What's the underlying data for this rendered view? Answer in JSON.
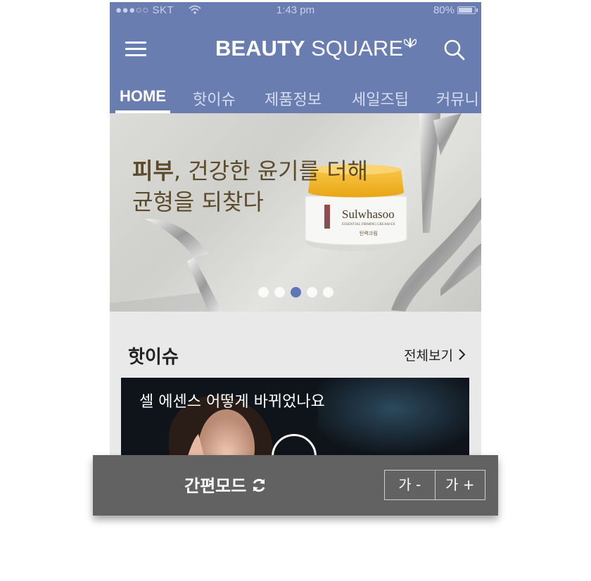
{
  "status_bar": {
    "carrier": "●●●○○ SKT",
    "time": "1:43 pm",
    "battery": "80%",
    "battery_level": 0.8
  },
  "header": {
    "logo_bold": "BEAUTY",
    "logo_light": "SQUARE",
    "menu_icon": "hamburger-menu-icon",
    "search_icon": "search-icon"
  },
  "tabs": [
    {
      "label": "HOME",
      "active": true
    },
    {
      "label": "핫이슈"
    },
    {
      "label": "제품정보"
    },
    {
      "label": "세일즈팁"
    },
    {
      "label": "커뮤니"
    }
  ],
  "banner": {
    "line1_bold": "피부",
    "line1_rest": ", 건강한 윤기를 더해",
    "line2": "균형을 되찾다",
    "product_brand": "Sulwhasoo",
    "product_sub": "ESSENTIAL FIRMING CREAM EX",
    "product_kor": "탄력크림",
    "slides_total": 5,
    "slide_active": 3
  },
  "hot_issue": {
    "title": "핫이슈",
    "view_all": "전체보기",
    "video_title": "셀 에센스 어떻게 바뀌었나요"
  },
  "bottom_bar": {
    "easy_mode": "간편모드",
    "font_decrease": "가 -",
    "font_increase": "가 +"
  },
  "colors": {
    "primary": "#6a7db0",
    "dot_active": "#5e76b8",
    "bar": "#626262"
  }
}
